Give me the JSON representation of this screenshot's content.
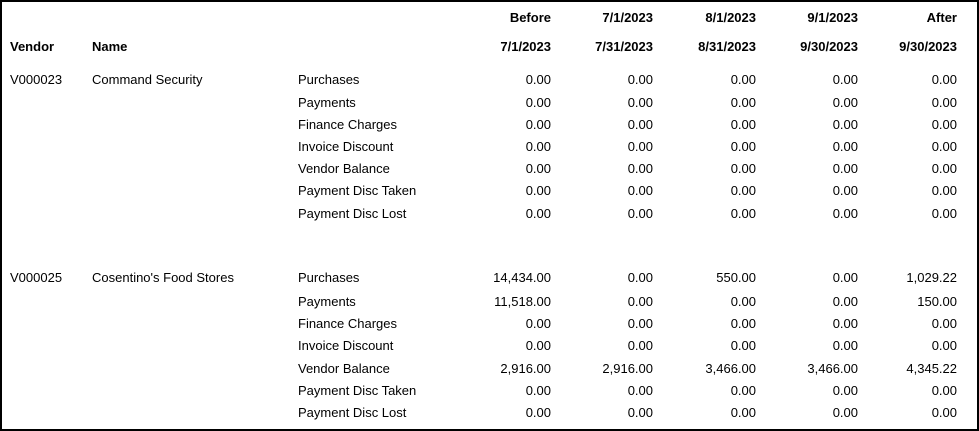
{
  "header": {
    "vendor_label": "Vendor",
    "name_label": "Name",
    "columns": [
      {
        "top": "Before",
        "bottom": "7/1/2023"
      },
      {
        "top": "7/1/2023",
        "bottom": "7/31/2023"
      },
      {
        "top": "8/1/2023",
        "bottom": "8/31/2023"
      },
      {
        "top": "9/1/2023",
        "bottom": "9/30/2023"
      },
      {
        "top": "After",
        "bottom": "9/30/2023"
      }
    ]
  },
  "vendors": [
    {
      "id": "V000023",
      "name": "Command Security",
      "rows": [
        {
          "label": "Purchases",
          "values": [
            "0.00",
            "0.00",
            "0.00",
            "0.00",
            "0.00"
          ]
        },
        {
          "label": "Payments",
          "values": [
            "0.00",
            "0.00",
            "0.00",
            "0.00",
            "0.00"
          ]
        },
        {
          "label": "Finance Charges",
          "values": [
            "0.00",
            "0.00",
            "0.00",
            "0.00",
            "0.00"
          ]
        },
        {
          "label": "Invoice Discount",
          "values": [
            "0.00",
            "0.00",
            "0.00",
            "0.00",
            "0.00"
          ]
        },
        {
          "label": "Vendor Balance",
          "values": [
            "0.00",
            "0.00",
            "0.00",
            "0.00",
            "0.00"
          ]
        },
        {
          "label": "Payment Disc Taken",
          "values": [
            "0.00",
            "0.00",
            "0.00",
            "0.00",
            "0.00"
          ]
        },
        {
          "label": "Payment Disc Lost",
          "values": [
            "0.00",
            "0.00",
            "0.00",
            "0.00",
            "0.00"
          ]
        }
      ]
    },
    {
      "id": "V000025",
      "name": "Cosentino's Food Stores",
      "rows": [
        {
          "label": "Purchases",
          "values": [
            "14,434.00",
            "0.00",
            "550.00",
            "0.00",
            "1,029.22"
          ]
        },
        {
          "label": "Payments",
          "values": [
            "11,518.00",
            "0.00",
            "0.00",
            "0.00",
            "150.00"
          ]
        },
        {
          "label": "Finance Charges",
          "values": [
            "0.00",
            "0.00",
            "0.00",
            "0.00",
            "0.00"
          ]
        },
        {
          "label": "Invoice Discount",
          "values": [
            "0.00",
            "0.00",
            "0.00",
            "0.00",
            "0.00"
          ]
        },
        {
          "label": "Vendor Balance",
          "values": [
            "2,916.00",
            "2,916.00",
            "3,466.00",
            "3,466.00",
            "4,345.22"
          ]
        },
        {
          "label": "Payment Disc Taken",
          "values": [
            "0.00",
            "0.00",
            "0.00",
            "0.00",
            "0.00"
          ]
        },
        {
          "label": "Payment Disc Lost",
          "values": [
            "0.00",
            "0.00",
            "0.00",
            "0.00",
            "0.00"
          ]
        }
      ]
    }
  ]
}
